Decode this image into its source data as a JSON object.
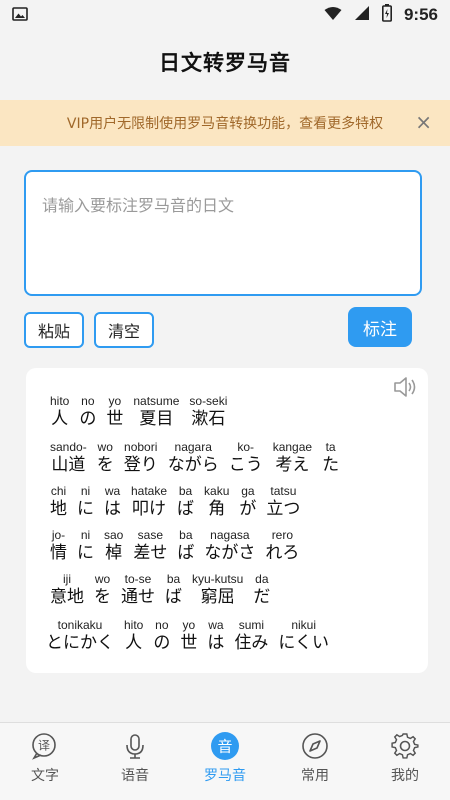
{
  "status": {
    "time": "9:56"
  },
  "title": "日文转罗马音",
  "vip_banner": {
    "text": "VIP用户无限制使用罗马音转换功能，查看更多特权",
    "close": "×"
  },
  "input": {
    "placeholder": "请输入要标注罗马音的日文",
    "value": ""
  },
  "buttons": {
    "paste": "粘贴",
    "clear": "清空",
    "annotate": "标注"
  },
  "result": {
    "lines": [
      [
        {
          "r": "hito",
          "w": "人"
        },
        {
          "r": "no",
          "w": "の"
        },
        {
          "r": "yo",
          "w": "世"
        },
        {
          "r": "natsume",
          "w": "夏目"
        },
        {
          "r": "so-seki",
          "w": "漱石"
        }
      ],
      [
        {
          "r": "sando-",
          "w": "山道"
        },
        {
          "r": "wo",
          "w": "を"
        },
        {
          "r": "nobori",
          "w": "登り"
        },
        {
          "r": "nagara",
          "w": "ながら"
        },
        {
          "r": "ko-",
          "w": "こう"
        },
        {
          "r": "kangae",
          "w": "考え"
        },
        {
          "r": "ta",
          "w": "た"
        }
      ],
      [
        {
          "r": "chi",
          "w": "地"
        },
        {
          "r": "ni",
          "w": "に"
        },
        {
          "r": "wa",
          "w": "は"
        },
        {
          "r": "hatake",
          "w": "叩け"
        },
        {
          "r": "ba",
          "w": "ば"
        },
        {
          "r": "kaku",
          "w": "角"
        },
        {
          "r": "ga",
          "w": "が"
        },
        {
          "r": "tatsu",
          "w": "立つ"
        }
      ],
      [
        {
          "r": "jo-",
          "w": "情"
        },
        {
          "r": "ni",
          "w": "に"
        },
        {
          "r": "sao",
          "w": "棹"
        },
        {
          "r": "sase",
          "w": "差せ"
        },
        {
          "r": "ba",
          "w": "ば"
        },
        {
          "r": "nagasa",
          "w": "ながさ"
        },
        {
          "r": "rero",
          "w": "れろ"
        }
      ],
      [
        {
          "r": "iji",
          "w": "意地"
        },
        {
          "r": "wo",
          "w": "を"
        },
        {
          "r": "to-se",
          "w": "通せ"
        },
        {
          "r": "ba",
          "w": "ば"
        },
        {
          "r": "kyu-kutsu",
          "w": "窮屈"
        },
        {
          "r": "da",
          "w": "だ"
        }
      ],
      [
        {
          "r": "tonikaku",
          "w": "とにかく"
        },
        {
          "r": "hito",
          "w": "人"
        },
        {
          "r": "no",
          "w": "の"
        },
        {
          "r": "yo",
          "w": "世"
        },
        {
          "r": "wa",
          "w": "は"
        },
        {
          "r": "sumi",
          "w": "住み"
        },
        {
          "r": "nikui",
          "w": "にくい"
        }
      ]
    ]
  },
  "tabs": [
    {
      "label": "文字",
      "icon": "translate-icon",
      "active": false
    },
    {
      "label": "语音",
      "icon": "microphone-icon",
      "active": false
    },
    {
      "label": "罗马音",
      "icon": "romaji-icon",
      "active": true
    },
    {
      "label": "常用",
      "icon": "compass-icon",
      "active": false
    },
    {
      "label": "我的",
      "icon": "gear-icon",
      "active": false
    }
  ],
  "colors": {
    "accent": "#2f9bf1",
    "banner_bg": "#fbe6c2",
    "banner_text": "#a0682a"
  }
}
